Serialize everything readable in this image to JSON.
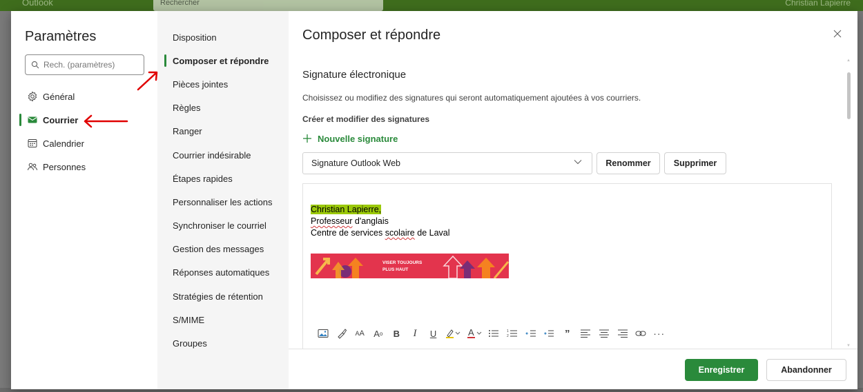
{
  "background": {
    "app_name": "Outlook",
    "search_placeholder": "Rechercher",
    "user_name": "Christian Lapierre"
  },
  "colors": {
    "accent": "#2a8a3b",
    "highlight": "#9bc90a",
    "annotation_arrow": "#e00000"
  },
  "settings": {
    "title": "Paramètres",
    "search": {
      "placeholder": "Rech. (paramètres)",
      "icon": "search-icon"
    },
    "categories": [
      {
        "label": "Général",
        "icon": "gear-icon",
        "active": false
      },
      {
        "label": "Courrier",
        "icon": "mail-icon",
        "active": true
      },
      {
        "label": "Calendrier",
        "icon": "calendar-icon",
        "active": false
      },
      {
        "label": "Personnes",
        "icon": "people-icon",
        "active": false
      }
    ]
  },
  "subnav": {
    "items": [
      {
        "label": "Disposition",
        "active": false
      },
      {
        "label": "Composer et répondre",
        "active": true
      },
      {
        "label": "Pièces jointes",
        "active": false
      },
      {
        "label": "Règles",
        "active": false
      },
      {
        "label": "Ranger",
        "active": false
      },
      {
        "label": "Courrier indésirable",
        "active": false
      },
      {
        "label": "Étapes rapides",
        "active": false
      },
      {
        "label": "Personnaliser les actions",
        "active": false
      },
      {
        "label": "Synchroniser le courriel",
        "active": false
      },
      {
        "label": "Gestion des messages",
        "active": false
      },
      {
        "label": "Réponses automatiques",
        "active": false
      },
      {
        "label": "Stratégies de rétention",
        "active": false
      },
      {
        "label": "S/MIME",
        "active": false
      },
      {
        "label": "Groupes",
        "active": false
      }
    ]
  },
  "content": {
    "title": "Composer et répondre",
    "signature": {
      "heading": "Signature électronique",
      "description": "Choisissez ou modifiez des signatures qui seront automatiquement ajoutées à vos courriers.",
      "subheading": "Créer et modifier des signatures",
      "new_signature": "Nouvelle signature",
      "selected": "Signature Outlook Web",
      "rename": "Renommer",
      "delete": "Supprimer",
      "lines": {
        "name": "Christian Lapierre,",
        "role_word1": "Professeur",
        "role_rest": " d'anglais",
        "org_pre": "Centre de services ",
        "org_sq": "scolaire",
        "org_post": " de Laval"
      },
      "banner": {
        "line1": "VISER TOUJOURS",
        "line2": "PLUS HAUT"
      }
    },
    "toolbar": {
      "font_size_label": "A",
      "bold": "B",
      "italic": "I",
      "underline": "U",
      "font_color": "A",
      "quote": "”",
      "more": "···"
    }
  },
  "footer": {
    "save": "Enregistrer",
    "cancel": "Abandonner"
  }
}
